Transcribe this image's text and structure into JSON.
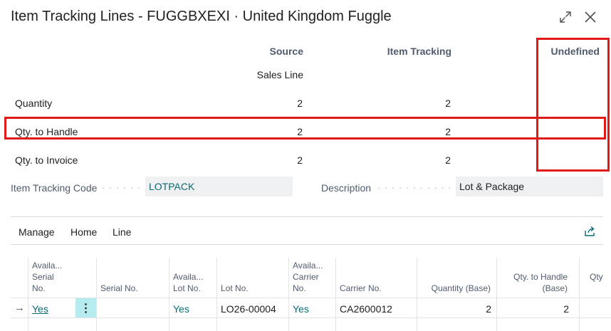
{
  "window": {
    "title": "Item Tracking Lines - FUGGBXEXI · United Kingdom Fuggle",
    "expand_icon": "expand-icon",
    "close_icon": "close-icon"
  },
  "summary": {
    "headers": {
      "source": "Source",
      "item_tracking": "Item Tracking",
      "undefined": "Undefined"
    },
    "source_subtitle": "Sales Line",
    "rows": [
      {
        "label": "Quantity",
        "source": "2",
        "item_tracking": "2",
        "undefined": ""
      },
      {
        "label": "Qty. to Handle",
        "source": "2",
        "item_tracking": "2",
        "undefined": ""
      },
      {
        "label": "Qty. to Invoice",
        "source": "2",
        "item_tracking": "2",
        "undefined": ""
      }
    ]
  },
  "fields": {
    "item_tracking_code": {
      "label": "Item Tracking Code",
      "value": "LOTPACK"
    },
    "description": {
      "label": "Description",
      "value": "Lot & Package"
    }
  },
  "menu": {
    "items": [
      "Manage",
      "Home",
      "Line"
    ],
    "share_icon": "share-icon"
  },
  "grid": {
    "columns": {
      "avail_serial": [
        "Availa...",
        "Serial",
        "No."
      ],
      "serial_no": "Serial No.",
      "avail_lot": [
        "Availa...",
        "Lot No."
      ],
      "lot_no": "Lot No.",
      "avail_carrier": [
        "Availa...",
        "Carrier",
        "No."
      ],
      "carrier_no": "Carrier No.",
      "quantity_base": "Quantity (Base)",
      "qty_to_handle": [
        "Qty. to Handle",
        "(Base)"
      ],
      "qty_more": "Qty"
    },
    "rows": [
      {
        "indicator": "→",
        "avail_serial": "Yes",
        "serial_no": "",
        "avail_lot": "Yes",
        "lot_no": "LO26-00004",
        "avail_carrier": "Yes",
        "carrier_no": "CA2600012",
        "quantity_base": "2",
        "qty_to_handle": "2"
      }
    ]
  },
  "colors": {
    "highlight": "#e01919",
    "link": "#0b6a73",
    "selected_cell": "#b6ecef"
  }
}
